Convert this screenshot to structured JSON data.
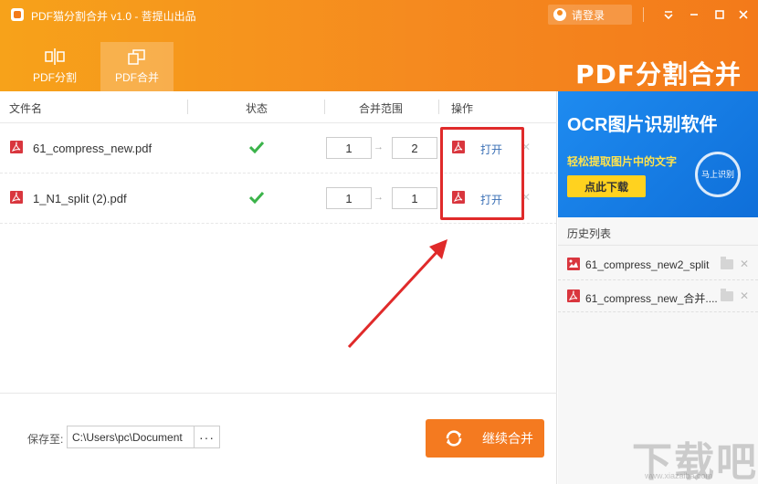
{
  "window": {
    "title": "PDF猫分割合并 v1.0 - 菩提山出品",
    "login_label": "请登录"
  },
  "nav": {
    "tabs": [
      {
        "label": "PDF分割"
      },
      {
        "label": "PDF合并"
      }
    ],
    "brand": "PDF分割合并"
  },
  "table": {
    "headers": [
      "文件名",
      "状态",
      "合并范围",
      "操作"
    ],
    "rows": [
      {
        "file": "61_compress_new.pdf",
        "status": "done",
        "from": "1",
        "to": "2",
        "action": "打开"
      },
      {
        "file": "1_N1_split (2).pdf",
        "status": "done",
        "from": "1",
        "to": "1",
        "action": "打开"
      }
    ],
    "arrow_glyph": "→"
  },
  "footer": {
    "save_label": "保存至:",
    "save_path": "C:\\Users\\pc\\Document",
    "browse_label": "···",
    "merge_label": "继续合并"
  },
  "ad": {
    "title": "OCR图片识别软件",
    "subtitle": "轻松提取图片中的文字",
    "button": "点此下载",
    "badge": "马上识别"
  },
  "history": {
    "title": "历史列表",
    "items": [
      {
        "name": "61_compress_new2_split",
        "type": "image"
      },
      {
        "name": "61_compress_new_合并....",
        "type": "pdf"
      }
    ]
  },
  "watermark": {
    "text": "下载吧",
    "url": "www.xiazaiba.com"
  },
  "colors": {
    "header_orange": "#f58a1f",
    "accent_orange": "#f47a20",
    "pdf_red": "#d9363e",
    "link_blue": "#3a6fb5",
    "check_green": "#3bb34a",
    "highlight_red": "#e02a2a"
  }
}
